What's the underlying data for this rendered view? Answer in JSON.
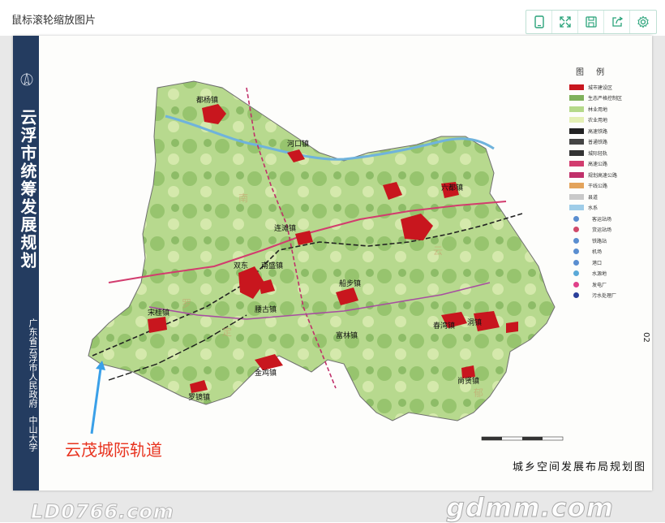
{
  "window": {
    "title": "鼠标滚轮缩放图片"
  },
  "toolbar": {
    "buttons": [
      {
        "icon": "tablet-icon"
      },
      {
        "icon": "fullscreen-icon"
      },
      {
        "icon": "save-icon"
      },
      {
        "icon": "share-icon"
      },
      {
        "icon": "settings-icon"
      }
    ]
  },
  "document": {
    "spine_title": "云浮市统筹发展规划",
    "spine_org": "广东省云浮市人民政府",
    "spine_univ": "中山大学",
    "map_caption": "城乡空间发展布局规划图",
    "page_number": "02"
  },
  "legend": {
    "title": "图 例",
    "items": [
      {
        "label": "城市建设区",
        "color": "#c8161e"
      },
      {
        "label": "生态严格控制区",
        "color": "#7fb15b"
      },
      {
        "label": "林业用地",
        "color": "#b5d98a"
      },
      {
        "label": "农业用地",
        "color": "#e4f0b4"
      },
      {
        "label": "高速铁路",
        "color": "#222222"
      },
      {
        "label": "普通铁路",
        "color": "#444444"
      },
      {
        "label": "城际轻轨",
        "color": "#333333"
      },
      {
        "label": "高速公路",
        "color": "#d23c6e"
      },
      {
        "label": "规划高速公路",
        "color": "#c0306a"
      },
      {
        "label": "干线公路",
        "color": "#e3a35b"
      },
      {
        "label": "县道",
        "color": "#c9c9c9"
      },
      {
        "label": "水系",
        "color": "#9fcde8"
      },
      {
        "label": "客运站场",
        "color": "#5a8ed0"
      },
      {
        "label": "货运站场",
        "color": "#d04a6a"
      },
      {
        "label": "铁路站",
        "color": "#5a8ed0"
      },
      {
        "label": "机场",
        "color": "#5a8ed0"
      },
      {
        "label": "港口",
        "color": "#5a8ed0"
      },
      {
        "label": "水源地",
        "color": "#5aa9d8"
      },
      {
        "label": "发电厂",
        "color": "#e0408a"
      },
      {
        "label": "污水处理厂",
        "color": "#2a3f9a"
      }
    ]
  },
  "map": {
    "towns": [
      "都杨镇",
      "河口镇",
      "连滩镇",
      "双东",
      "南盛镇",
      "船步镇",
      "六都镇",
      "宋桂镇",
      "腰古镇",
      "罗镜镇",
      "金鸡镇",
      "富林镇",
      "春湾镇",
      "洞镇",
      "尚贤镇"
    ],
    "regions": [
      "南",
      "云",
      "罗",
      "定",
      "郁"
    ]
  },
  "annotation": {
    "text": "云茂城际轨道",
    "color": "#e8321e"
  },
  "watermarks": {
    "left": "LD0766.com",
    "right": "gdmm.com"
  }
}
